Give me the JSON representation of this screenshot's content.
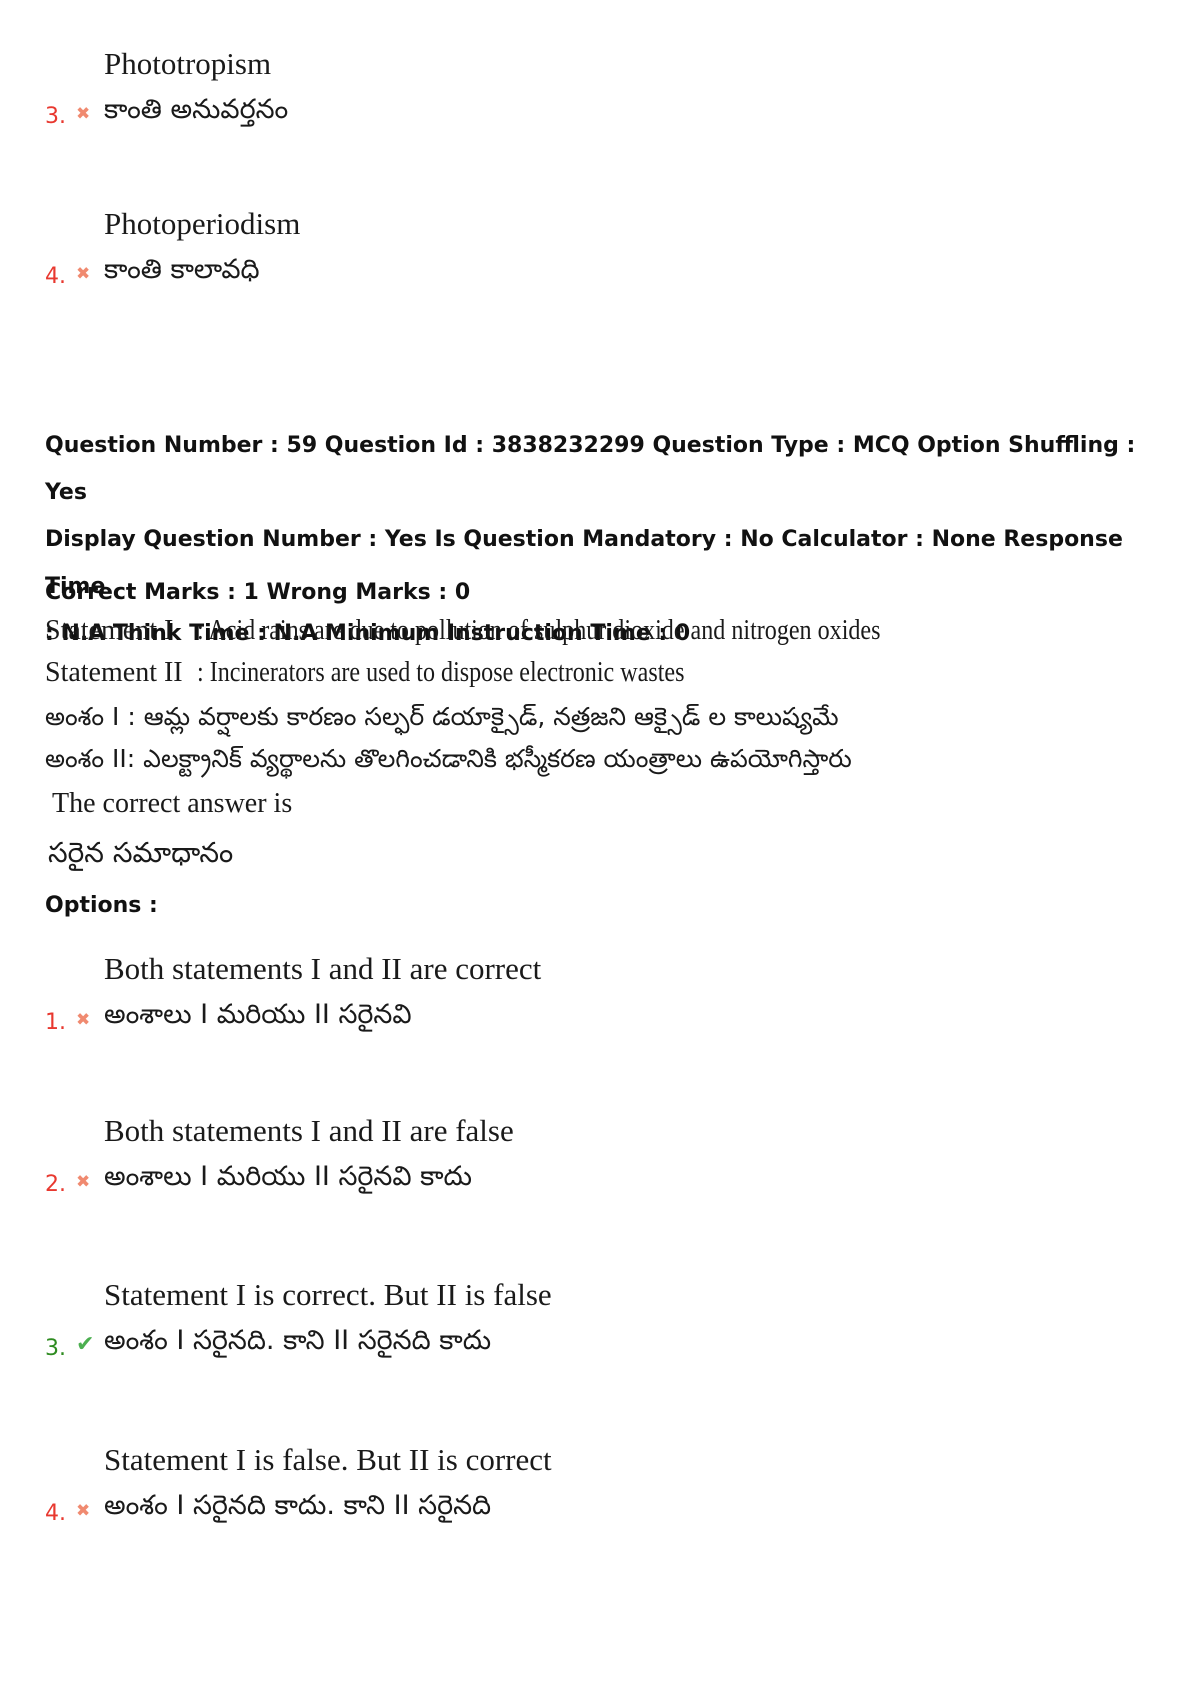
{
  "previous_options": [
    {
      "number": "3.",
      "english": "Phototropism",
      "telugu": "కాంతి అనువర్తనం",
      "status": "wrong"
    },
    {
      "number": "4.",
      "english": "Photoperiodism",
      "telugu": "కాంతి కాలావధి",
      "status": "wrong"
    }
  ],
  "question": {
    "meta_line1": "Question Number : 59 Question Id : 3838232299 Question Type : MCQ Option Shuffling : Yes",
    "meta_line2": "Display Question Number : Yes Is Question Mandatory : No Calculator : None Response Time",
    "meta_line3": ": N.A Think Time : N.A Minimum Instruction Time : 0",
    "marks": "Correct Marks : 1 Wrong Marks : 0",
    "statement1_label": "Statement I",
    "statement1_text": ": Acid rains are due to pollution of sulphur dioxide and nitrogen oxides",
    "statement2_label": "Statement II",
    "statement2_text": ": Incinerators are used to dispose electronic wastes",
    "telugu_statement1": "అంశం I : ఆమ్ల వర్షాలకు కారణం సల్ఫర్ డయాక్సైడ్, నత్రజని ఆక్సైడ్ ల కాలుష్యమే",
    "telugu_statement2": "అంశం II:  ఎలక్ట్రానిక్ వ్యర్థాలను తొలగించడానికి భస్మీకరణ యంత్రాలు ఉపయోగిస్తారు",
    "correct_answer_en": "The correct answer is",
    "correct_answer_te": "సరైన సమాధానం",
    "options_label": "Options :"
  },
  "options": [
    {
      "number": "1.",
      "english": "Both statements I and II are correct",
      "telugu": "అంశాలు I మరియు II సరైనవి",
      "status": "wrong"
    },
    {
      "number": "2.",
      "english": "Both statements I and II are false",
      "telugu": "అంశాలు I మరియు II సరైనవి కాదు",
      "status": "wrong"
    },
    {
      "number": "3.",
      "english": "Statement I is correct. But II is false",
      "telugu": "అంశం I సరైనది. కాని II సరైనది కాదు",
      "status": "correct"
    },
    {
      "number": "4.",
      "english": "Statement I is false. But II is correct",
      "telugu": "అంశం I సరైనది కాదు. కాని II సరైనది",
      "status": "wrong"
    }
  ],
  "icons": {
    "wrong": "✖",
    "correct": "✔"
  },
  "colors": {
    "wrong_number": "#e8382f",
    "correct_number": "#2e8b20",
    "wrong_icon": "#f08a70",
    "correct_icon": "#4caf50"
  }
}
